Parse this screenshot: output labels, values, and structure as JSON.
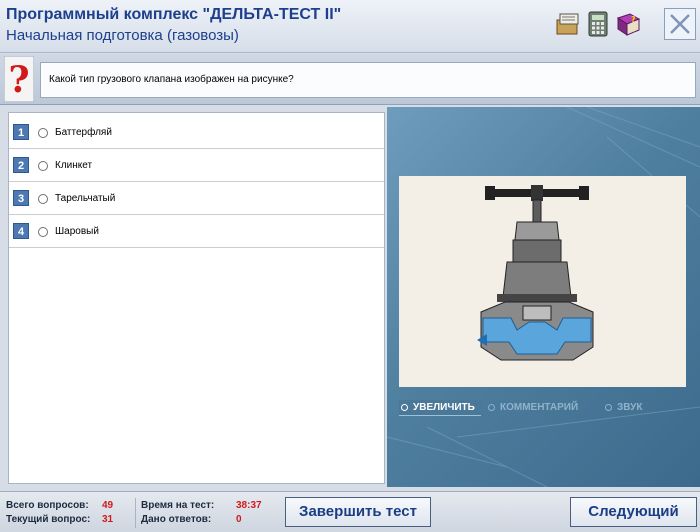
{
  "header": {
    "title": "Программный комплекс \"ДЕЛЬТА-ТЕСТ II\"",
    "subtitle": "Начальная подготовка (газовозы)",
    "icons": [
      "notebook-icon",
      "calculator-icon",
      "help-book-icon",
      "close-icon"
    ]
  },
  "question": {
    "text": "Какой тип грузового клапана изображен на рисунке?"
  },
  "answers": [
    {
      "num": "1",
      "label": "Баттерфляй"
    },
    {
      "num": "2",
      "label": "Клинкет"
    },
    {
      "num": "3",
      "label": "Тарельчатый"
    },
    {
      "num": "4",
      "label": "Шаровый"
    }
  ],
  "image_toolbar": {
    "zoom": "УВЕЛИЧИТЬ",
    "comment": "КОММЕНТАРИЙ",
    "sound": "ЗВУК"
  },
  "status": {
    "total_label": "Всего вопросов:",
    "total_value": "49",
    "current_label": "Текущий вопрос:",
    "current_value": "31",
    "time_label": "Время на тест:",
    "time_value": "38:37",
    "answered_label": "Дано ответов:",
    "answered_value": "0"
  },
  "buttons": {
    "finish": "Завершить тест",
    "next": "Следующий"
  },
  "colors": {
    "title": "#1d3f8c",
    "status_value": "#d01a1a",
    "number_badge": "#4d79b3"
  }
}
